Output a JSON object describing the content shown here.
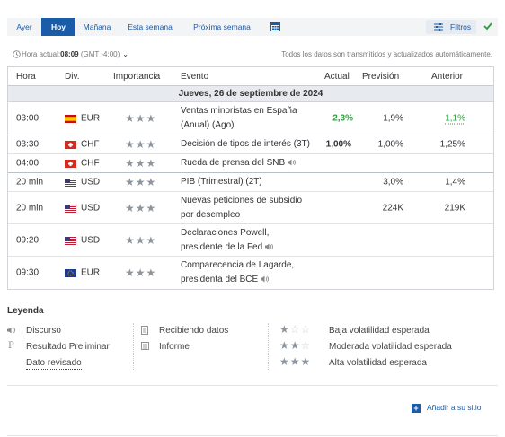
{
  "tabs": [
    "Ayer",
    "Hoy",
    "Mañana",
    "Esta semana",
    "Próxima semana"
  ],
  "active_tab": "Hoy",
  "icons": {
    "calendar": "calendar-icon",
    "filters": "sliders-icon",
    "check": "check-icon",
    "clock": "clock-icon",
    "speaker": "speaker-icon"
  },
  "filters_label": "Filtros",
  "time": {
    "prefix": "Hora actual:",
    "value": "08:09",
    "tz": "(GMT -4:00)",
    "caret": "⌄"
  },
  "notice": "Todos los datos son transmitidos y actualizados automáticamente.",
  "columns": {
    "hora": "Hora",
    "div": "Div.",
    "importancia": "Importancia",
    "evento": "Evento",
    "actual": "Actual",
    "prevision": "Previsión",
    "anterior": "Anterior"
  },
  "day_header": "Jueves, 26 de septiembre de 2024",
  "stars": "★★★",
  "rows": [
    {
      "hora": "03:00",
      "div": "EUR",
      "country": "es",
      "evento_l1": "Ventas minoristas en España",
      "evento_l2": "(Anual) (Ago)",
      "actual": "2,3%",
      "prevision": "1,9%",
      "anterior": "1,1%"
    },
    {
      "hora": "03:30",
      "div": "CHF",
      "country": "ch",
      "evento_l1": "Decisión de tipos de interés (3T)",
      "evento_l2": "",
      "actual": "1,00%",
      "prevision": "1,00%",
      "anterior": "1,25%"
    },
    {
      "hora": "04:00",
      "div": "CHF",
      "country": "ch",
      "evento_l1": "Rueda de prensa del SNB",
      "evento_l2": "",
      "actual": "",
      "prevision": "",
      "anterior": ""
    },
    {
      "hora": "20 min",
      "div": "USD",
      "country": "us",
      "evento_l1": "PIB (Trimestral) (2T)",
      "evento_l2": "",
      "actual": "",
      "prevision": "3,0%",
      "anterior": "1,4%"
    },
    {
      "hora": "20 min",
      "div": "USD",
      "country": "us",
      "evento_l1": "Nuevas peticiones de subsidio",
      "evento_l2": "por desempleo",
      "actual": "",
      "prevision": "224K",
      "anterior": "219K"
    },
    {
      "hora": "09:20",
      "div": "USD",
      "country": "us",
      "evento_l1": "Declaraciones Powell,",
      "evento_l2": "presidente de la Fed",
      "actual": "",
      "prevision": "",
      "anterior": ""
    },
    {
      "hora": "09:30",
      "div": "EUR",
      "country": "eu",
      "evento_l1": "Comparecencia de Lagarde,",
      "evento_l2": "presidenta del BCE",
      "actual": "",
      "prevision": "",
      "anterior": ""
    }
  ],
  "legend": {
    "title": "Leyenda",
    "discurso": "Discurso",
    "resultado": "Resultado Preliminar",
    "revisado": "Dato revisado",
    "recibiendo": "Recibiendo datos",
    "informe": "Informe",
    "baja": "Baja volatilidad esperada",
    "moderada": "Moderada volatilidad esperada",
    "alta": "Alta volatilidad esperada",
    "p_glyph": "P"
  },
  "add_site": "Añadir a su sitio",
  "colors": {
    "accent": "#1b5ca8",
    "green": "#2aa138",
    "tabbar": "#f2f4f6",
    "dayrow": "#e7eaee"
  }
}
